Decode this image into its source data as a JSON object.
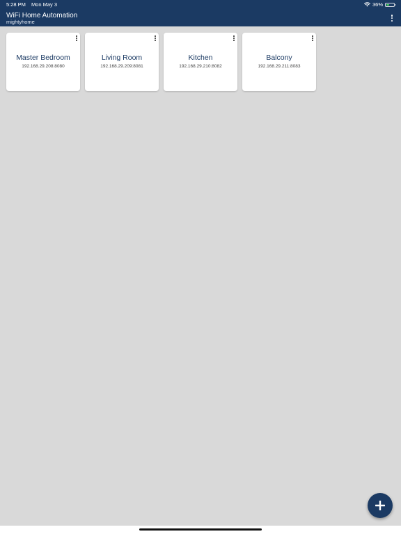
{
  "status_bar": {
    "time": "5:28 PM",
    "date": "Mon May 3",
    "battery_text": "36%",
    "battery_level": 0.36,
    "icons": [
      "wifi-icon",
      "battery-icon"
    ]
  },
  "app_bar": {
    "title": "WiFi Home Automation",
    "subtitle": "mightyhome",
    "menu_icon": "more-vertical-icon"
  },
  "rooms": [
    {
      "name": "Master Bedroom",
      "address": "192.168.29.208:8080"
    },
    {
      "name": "Living Room",
      "address": "192.168.29.209:8081"
    },
    {
      "name": "Kitchen",
      "address": "192.168.29.210:8082"
    },
    {
      "name": "Balcony",
      "address": "192.168.29.211:8083"
    }
  ],
  "fab": {
    "icon": "plus-icon"
  },
  "colors": {
    "primary": "#1b3a63",
    "background": "#d9d9d9",
    "card": "#ffffff",
    "battery": "#4cd964"
  }
}
